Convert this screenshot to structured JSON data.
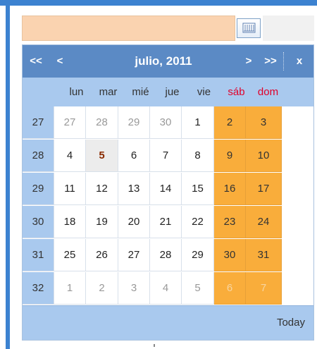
{
  "datepicker": {
    "input_value": "",
    "calendar_button_icon": "calendar-icon"
  },
  "calendar": {
    "nav": {
      "prev_year": "<<",
      "prev_month": "<",
      "next_month": ">",
      "next_year": ">>",
      "close": "x"
    },
    "title": "julio, 2011",
    "weekdays": [
      "lun",
      "mar",
      "mié",
      "jue",
      "vie",
      "sáb",
      "dom"
    ],
    "weeks": [
      {
        "week": "27",
        "days": [
          "27",
          "28",
          "29",
          "30",
          "1",
          "2",
          "3"
        ]
      },
      {
        "week": "28",
        "days": [
          "4",
          "5",
          "6",
          "7",
          "8",
          "9",
          "10"
        ]
      },
      {
        "week": "29",
        "days": [
          "11",
          "12",
          "13",
          "14",
          "15",
          "16",
          "17"
        ]
      },
      {
        "week": "30",
        "days": [
          "18",
          "19",
          "20",
          "21",
          "22",
          "23",
          "24"
        ]
      },
      {
        "week": "31",
        "days": [
          "25",
          "26",
          "27",
          "28",
          "29",
          "30",
          "31"
        ]
      },
      {
        "week": "32",
        "days": [
          "1",
          "2",
          "3",
          "4",
          "5",
          "6",
          "7"
        ]
      }
    ],
    "footer": {
      "today_label": "Today"
    },
    "colors": {
      "header": "#5b8ac5",
      "weekday_row": "#a9c9ee",
      "weekend_cell": "#f9ad3b",
      "weekend_text": "#e0002a",
      "frame": "#3c82d0"
    }
  }
}
